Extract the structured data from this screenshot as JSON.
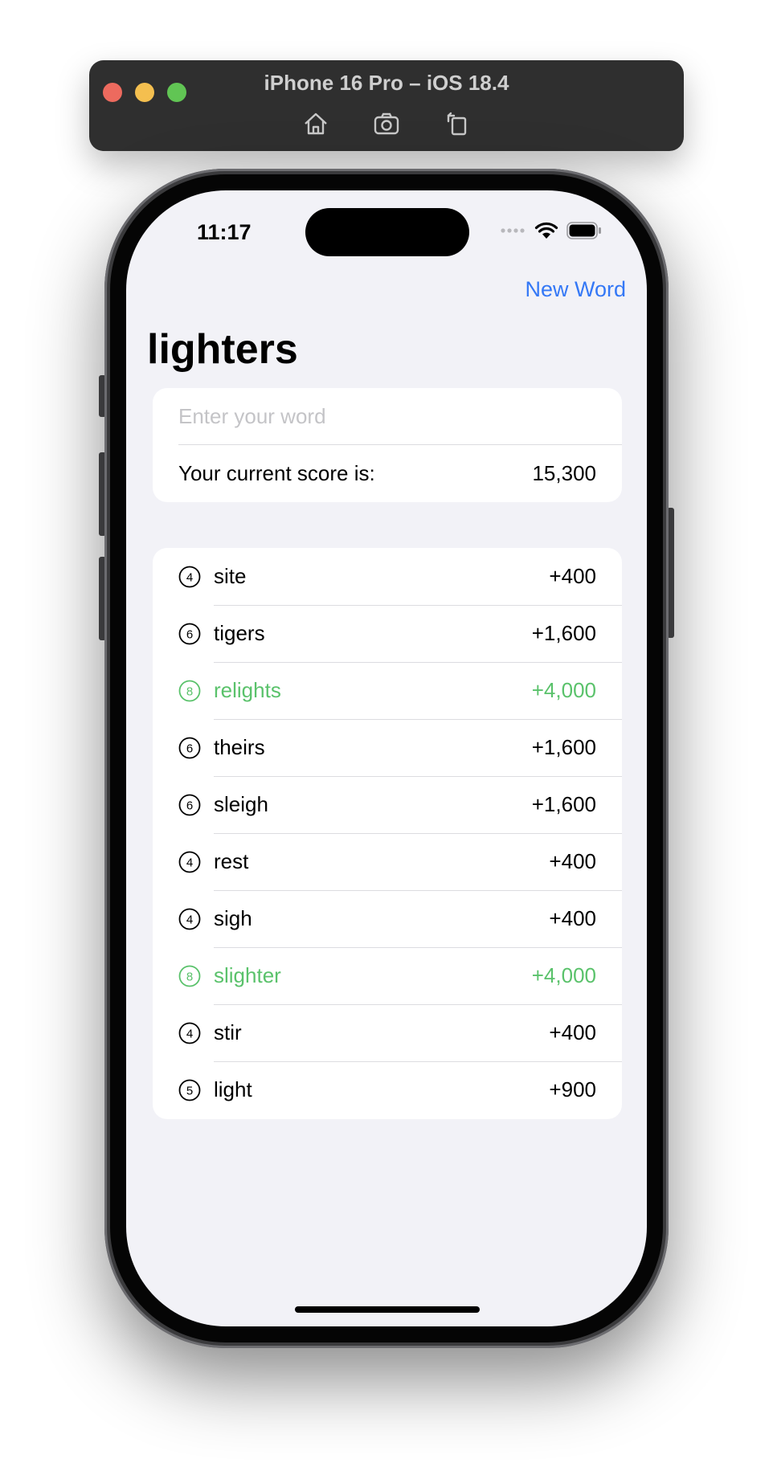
{
  "simulator": {
    "title": "iPhone 16 Pro – iOS 18.4",
    "tools": [
      "home-icon",
      "screenshot-icon",
      "rotate-icon"
    ]
  },
  "status_bar": {
    "time": "11:17"
  },
  "nav": {
    "new_word": "New Word"
  },
  "root_word": "lighters",
  "input": {
    "placeholder": "Enter your word",
    "value": ""
  },
  "score": {
    "label": "Your current score is:",
    "value": "15,300"
  },
  "colors": {
    "accent": "#3478f6",
    "highlight": "#5ac26b",
    "text": "#000000"
  },
  "words": [
    {
      "length": "4",
      "word": "site",
      "points": "+400",
      "highlight": false
    },
    {
      "length": "6",
      "word": "tigers",
      "points": "+1,600",
      "highlight": false
    },
    {
      "length": "8",
      "word": "relights",
      "points": "+4,000",
      "highlight": true
    },
    {
      "length": "6",
      "word": "theirs",
      "points": "+1,600",
      "highlight": false
    },
    {
      "length": "6",
      "word": "sleigh",
      "points": "+1,600",
      "highlight": false
    },
    {
      "length": "4",
      "word": "rest",
      "points": "+400",
      "highlight": false
    },
    {
      "length": "4",
      "word": "sigh",
      "points": "+400",
      "highlight": false
    },
    {
      "length": "8",
      "word": "slighter",
      "points": "+4,000",
      "highlight": true
    },
    {
      "length": "4",
      "word": "stir",
      "points": "+400",
      "highlight": false
    },
    {
      "length": "5",
      "word": "light",
      "points": "+900",
      "highlight": false
    }
  ]
}
